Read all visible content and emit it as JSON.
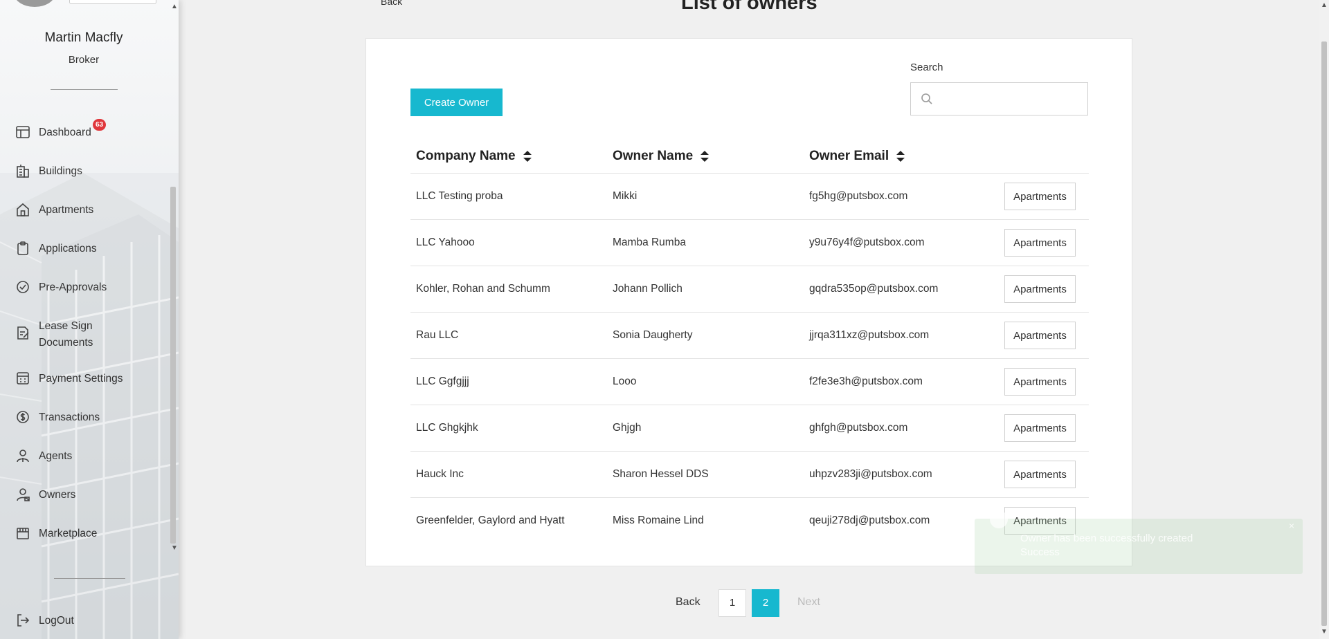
{
  "user": {
    "name": "Martin Macfly",
    "role": "Broker"
  },
  "sidebar": {
    "items": [
      {
        "label": "Dashboard",
        "badge": "63",
        "icon": "dashboard-icon"
      },
      {
        "label": "Buildings",
        "icon": "building-icon"
      },
      {
        "label": "Apartments",
        "icon": "home-icon"
      },
      {
        "label": "Applications",
        "icon": "clipboard-icon"
      },
      {
        "label": "Pre-Approvals",
        "icon": "check-circle-icon"
      },
      {
        "label": "Lease Sign Documents",
        "icon": "document-sign-icon"
      },
      {
        "label": "Payment Settings",
        "icon": "calculator-icon"
      },
      {
        "label": "Transactions",
        "icon": "money-icon"
      },
      {
        "label": "Agents",
        "icon": "agent-icon"
      },
      {
        "label": "Owners",
        "icon": "owner-icon"
      },
      {
        "label": "Marketplace",
        "icon": "store-icon"
      }
    ],
    "logout": "LogOut"
  },
  "header": {
    "back": "Back",
    "title": "List of owners"
  },
  "toolbar": {
    "create_label": "Create Owner",
    "search_label": "Search",
    "search_value": ""
  },
  "table": {
    "columns": [
      "Company Name",
      "Owner Name",
      "Owner Email"
    ],
    "action_label": "Apartments",
    "rows": [
      {
        "company": "LLC Testing proba",
        "owner": "Mikki",
        "email": "fg5hg@putsbox.com"
      },
      {
        "company": "LLC Yahooo",
        "owner": "Mamba Rumba",
        "email": "y9u76y4f@putsbox.com"
      },
      {
        "company": "Kohler, Rohan and Schumm",
        "owner": "Johann Pollich",
        "email": "gqdra535op@putsbox.com"
      },
      {
        "company": "Rau LLC",
        "owner": "Sonia Daugherty",
        "email": "jjrqa311xz@putsbox.com"
      },
      {
        "company": "LLC Ggfgjjj",
        "owner": "Looo",
        "email": "f2fe3e3h@putsbox.com"
      },
      {
        "company": "LLC Ghgkjhk",
        "owner": "Ghjgh",
        "email": "ghfgh@putsbox.com"
      },
      {
        "company": "Hauck Inc",
        "owner": "Sharon Hessel DDS",
        "email": "uhpzv283ji@putsbox.com"
      },
      {
        "company": "Greenfelder, Gaylord and Hyatt",
        "owner": "Miss Romaine Lind",
        "email": "qeuji278dj@putsbox.com"
      }
    ]
  },
  "pagination": {
    "back": "Back",
    "pages": [
      "1",
      "2"
    ],
    "current": "2",
    "next": "Next"
  },
  "toast": {
    "message": "Owner has been successfully created",
    "title": "Success"
  },
  "colors": {
    "accent": "#17b8cf",
    "badge": "#e0373c"
  }
}
